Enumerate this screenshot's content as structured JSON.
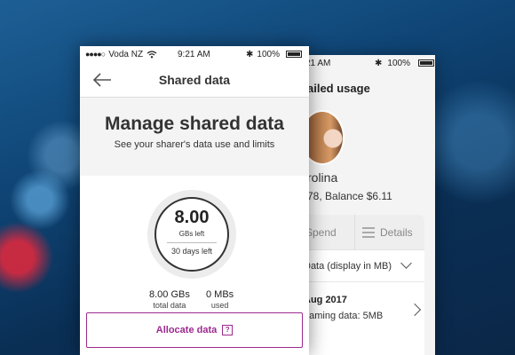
{
  "front": {
    "status": {
      "carrier": "Voda NZ",
      "time": "9:21 AM",
      "battery": "100%"
    },
    "nav": {
      "title": "Shared data"
    },
    "hero": {
      "title": "Manage shared data",
      "subtitle": "See your sharer's data use and limits"
    },
    "gauge": {
      "value": "8.00",
      "unit": "GBs left",
      "days": "30 days left"
    },
    "stats": {
      "total_value": "8.00 GBs",
      "total_label": "total data",
      "used_value": "0 MBs",
      "used_label": "used"
    },
    "allocate_label": "Allocate data",
    "help_glyph": "?"
  },
  "back": {
    "status": {
      "time": "21 AM",
      "battery": "100%"
    },
    "title": "ailed usage",
    "name": "rolina",
    "balance": "78, Balance $6.11",
    "tabs": {
      "spend": "Spend",
      "details": "Details"
    },
    "filter": "Data (display in MB)",
    "month": "Aug 2017",
    "roaming": "oaming data: 5MB"
  }
}
